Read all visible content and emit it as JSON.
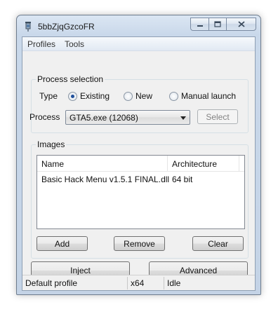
{
  "window": {
    "title": "5bbZjqGzcoFR"
  },
  "menu": {
    "items": [
      "Profiles",
      "Tools"
    ]
  },
  "process_selection": {
    "title": "Process selection",
    "type_label": "Type",
    "options": [
      "Existing",
      "New",
      "Manual launch"
    ],
    "selected_option": "Existing",
    "process_label": "Process",
    "process_value": "GTA5.exe (12068)",
    "select_button": "Select"
  },
  "images": {
    "title": "Images",
    "columns": [
      "Name",
      "Architecture"
    ],
    "rows": [
      {
        "name": "Basic Hack Menu v1.5.1 FINAL.dll",
        "architecture": "64 bit"
      }
    ],
    "add_button": "Add",
    "remove_button": "Remove",
    "clear_button": "Clear"
  },
  "actions": {
    "inject_button": "Inject",
    "advanced_button": "Advanced"
  },
  "status": {
    "profile": "Default profile",
    "arch": "x64",
    "state": "Idle"
  }
}
